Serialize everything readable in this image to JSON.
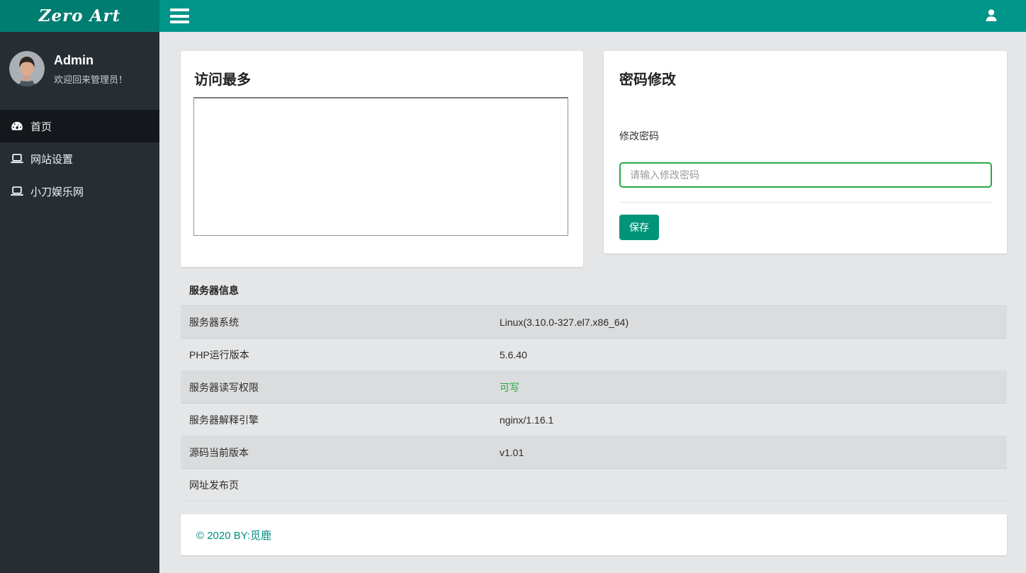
{
  "header": {
    "logo": "Zero Art"
  },
  "sidebar": {
    "user": {
      "name": "Admin",
      "welcome": "欢迎回来管理员！"
    },
    "items": [
      {
        "id": "home",
        "label": "首页",
        "icon": "dashboard",
        "active": true
      },
      {
        "id": "site-settings",
        "label": "网站设置",
        "icon": "laptop",
        "active": false
      },
      {
        "id": "xiaodao-site",
        "label": "小刀娱乐网",
        "icon": "laptop",
        "active": false
      }
    ]
  },
  "cards": {
    "visits": {
      "title": "访问最多"
    },
    "password": {
      "title": "密码修改",
      "label": "修改密码",
      "placeholder": "请输入修改密码",
      "value": "",
      "save_label": "保存"
    }
  },
  "server_table": {
    "title": "服务器信息",
    "rows": [
      {
        "label": "服务器系统",
        "value": "Linux(3.10.0-327.el7.x86_64)",
        "highlight": false
      },
      {
        "label": "PHP运行版本",
        "value": "5.6.40",
        "highlight": false
      },
      {
        "label": "服务器读写权限",
        "value": "可写",
        "highlight": true
      },
      {
        "label": "服务器解释引擎",
        "value": "nginx/1.16.1",
        "highlight": false
      },
      {
        "label": "源码当前版本",
        "value": "v1.01",
        "highlight": false
      },
      {
        "label": "网址发布页",
        "value": "",
        "highlight": false
      }
    ]
  },
  "footer": {
    "copyright": "© 2020 BY:觅鹿"
  },
  "colors": {
    "header_teal": "#009589",
    "logo_teal": "#007d71",
    "sidebar_dark": "#262e34",
    "active_nav": "#14181d",
    "button_teal": "#009578",
    "input_border_green": "#28a745",
    "success_green": "#28a745",
    "footer_text": "#008e82",
    "stripe_gray": "#dbdcdd",
    "page_bg": "#e5e6e7"
  }
}
